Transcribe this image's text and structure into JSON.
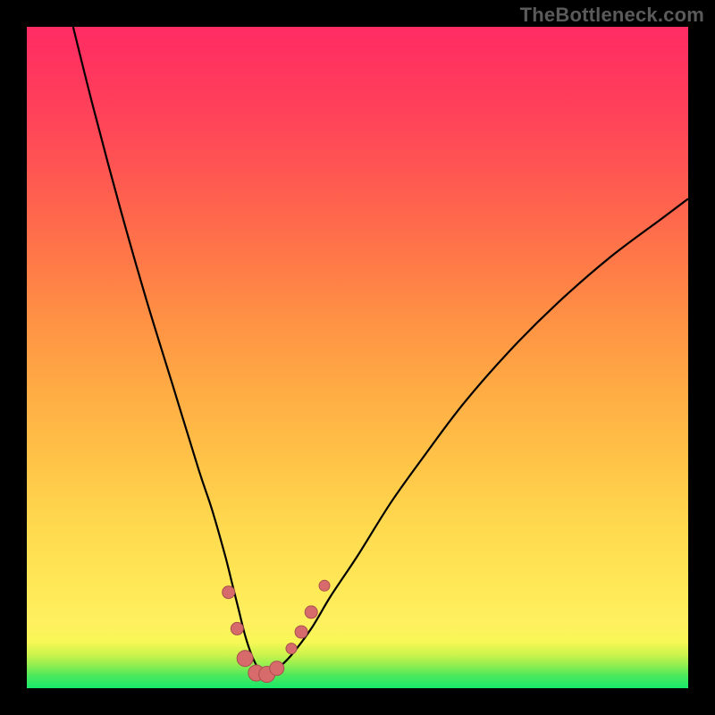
{
  "watermark": {
    "text": "TheBottleneck.com"
  },
  "colors": {
    "frame": "#000000",
    "curve_stroke": "#000000",
    "marker_fill": "#d76a6a",
    "marker_stroke": "#a84f4f"
  },
  "chart_data": {
    "type": "line",
    "title": "",
    "xlabel": "",
    "ylabel": "",
    "xlim": [
      0,
      100
    ],
    "ylim": [
      0,
      100
    ],
    "grid": false,
    "legend": false,
    "series": [
      {
        "name": "bottleneck-curve",
        "x": [
          7,
          10,
          14,
          18,
          22,
          26,
          28,
          30,
          31,
          32,
          33,
          34,
          35,
          36,
          37,
          38,
          40,
          43,
          46,
          50,
          55,
          60,
          66,
          73,
          80,
          88,
          96,
          100
        ],
        "y": [
          100,
          88,
          73,
          59,
          46,
          33,
          27,
          20,
          16,
          12,
          8,
          5,
          3,
          2,
          2,
          3,
          5,
          9,
          14,
          20,
          28,
          35,
          43,
          51,
          58,
          65,
          71,
          74
        ]
      }
    ],
    "markers": [
      {
        "x": 30.5,
        "y": 14.5,
        "r": 7
      },
      {
        "x": 31.8,
        "y": 9.0,
        "r": 7
      },
      {
        "x": 33.0,
        "y": 4.5,
        "r": 9
      },
      {
        "x": 34.7,
        "y": 2.3,
        "r": 9
      },
      {
        "x": 36.3,
        "y": 2.1,
        "r": 9
      },
      {
        "x": 37.8,
        "y": 3.0,
        "r": 8
      },
      {
        "x": 40.0,
        "y": 6.0,
        "r": 6
      },
      {
        "x": 41.5,
        "y": 8.5,
        "r": 7
      },
      {
        "x": 43.0,
        "y": 11.5,
        "r": 7
      },
      {
        "x": 45.0,
        "y": 15.5,
        "r": 6
      }
    ]
  }
}
